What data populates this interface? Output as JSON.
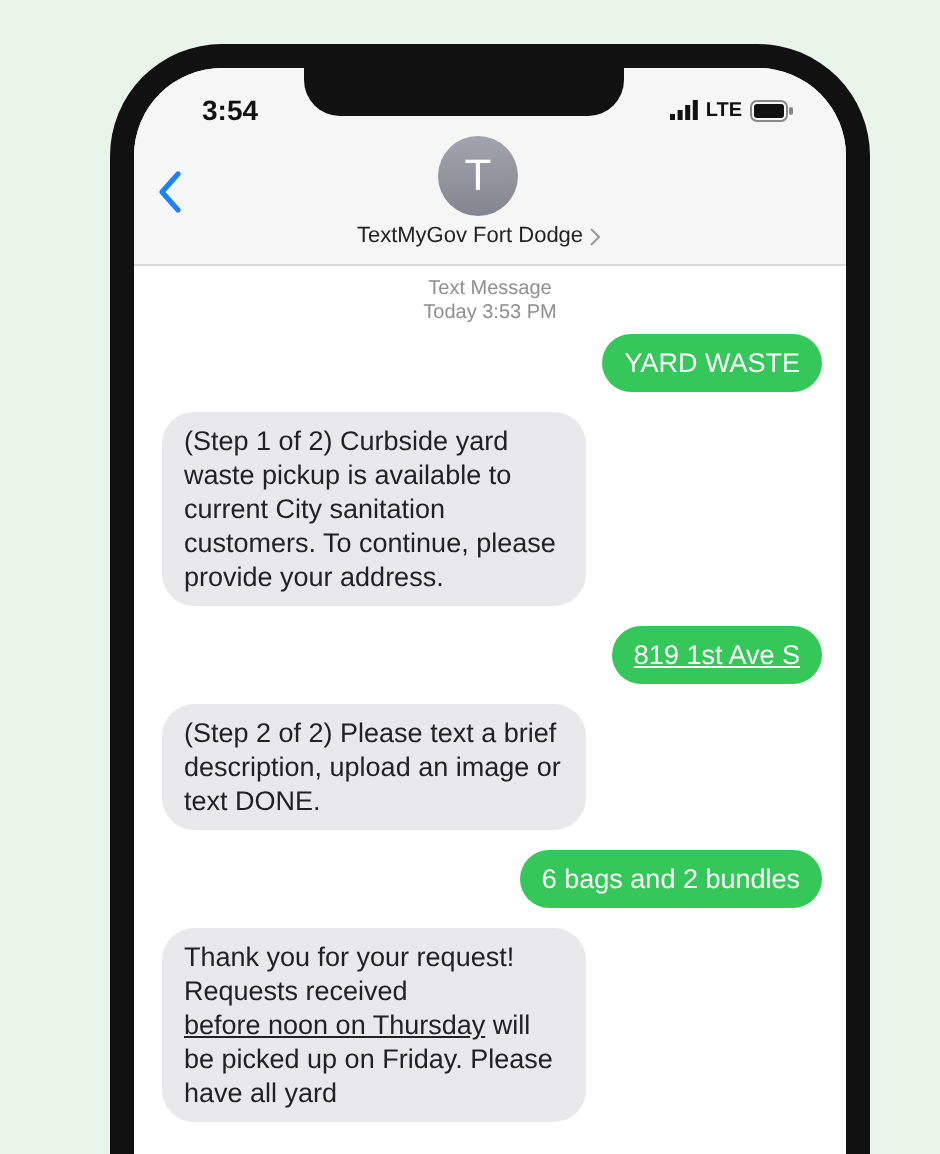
{
  "status_bar": {
    "time": "3:54",
    "network": "LTE"
  },
  "header": {
    "avatar_letter": "T",
    "contact": "TextMyGov Fort Dodge"
  },
  "thread_info": {
    "service": "Text Message",
    "timestamp": "Today 3:53 PM"
  },
  "messages": [
    {
      "kind": "sent",
      "parts": [
        {
          "text": "YARD WASTE",
          "link": false
        }
      ]
    },
    {
      "kind": "received",
      "parts": [
        {
          "text": "(Step 1 of 2) Curbside yard waste pickup is available to current City sanitation customers. To continue, please provide your address.",
          "link": false
        }
      ]
    },
    {
      "kind": "sent",
      "parts": [
        {
          "text": "819 1st Ave S",
          "link": true
        }
      ]
    },
    {
      "kind": "received",
      "parts": [
        {
          "text": "(Step 2 of 2) Please text a brief description, upload an image or text DONE.",
          "link": false
        }
      ]
    },
    {
      "kind": "sent",
      "parts": [
        {
          "text": "6 bags and 2 bundles",
          "link": false
        }
      ]
    },
    {
      "kind": "received",
      "parts": [
        {
          "text": "Thank you for your request! Requests received ",
          "link": false
        },
        {
          "text": "before noon on Thursday",
          "link": true
        },
        {
          "text": " will be picked up on Friday. Please have all yard",
          "link": false
        }
      ]
    }
  ]
}
